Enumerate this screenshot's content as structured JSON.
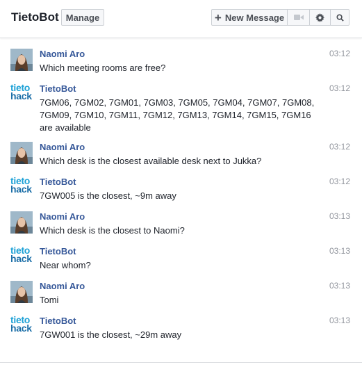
{
  "header": {
    "title": "TietoBot",
    "manage_label": "Manage",
    "new_message_label": "New Message"
  },
  "logo": {
    "line1": "tieto",
    "line2": "hack"
  },
  "messages": [
    {
      "sender": "Naomi Aro",
      "time": "03:12",
      "text": "Which meeting rooms are free?",
      "avatar": "user-photo"
    },
    {
      "sender": "TietoBot",
      "time": "03:12",
      "text": "7GM06, 7GM02, 7GM01, 7GM03, 7GM05, 7GM04, 7GM07, 7GM08, 7GM09, 7GM10, 7GM11, 7GM12, 7GM13, 7GM14, 7GM15, 7GM16 are available",
      "avatar": "tietohack-logo"
    },
    {
      "sender": "Naomi Aro",
      "time": "03:12",
      "text": "Which desk is the closest available desk next to Jukka?",
      "avatar": "user-photo"
    },
    {
      "sender": "TietoBot",
      "time": "03:12",
      "text": "7GW005 is the closest, ~9m away",
      "avatar": "tietohack-logo"
    },
    {
      "sender": "Naomi Aro",
      "time": "03:13",
      "text": "Which desk is the closest to Naomi?",
      "avatar": "user-photo"
    },
    {
      "sender": "TietoBot",
      "time": "03:13",
      "text": "Near whom?",
      "avatar": "tietohack-logo"
    },
    {
      "sender": "Naomi Aro",
      "time": "03:13",
      "text": "Tomi",
      "avatar": "user-photo"
    },
    {
      "sender": "TietoBot",
      "time": "03:13",
      "text": "7GW001 is the closest, ~29m away",
      "avatar": "tietohack-logo"
    }
  ],
  "icons": {
    "new_message": "plus-icon",
    "video": "video-camera-icon",
    "settings": "gear-icon",
    "search": "search-icon"
  },
  "colors": {
    "sender": "#365899",
    "timestamp": "#90949c",
    "logo_top": "#1da1d6",
    "logo_bottom": "#1c6fa8"
  }
}
